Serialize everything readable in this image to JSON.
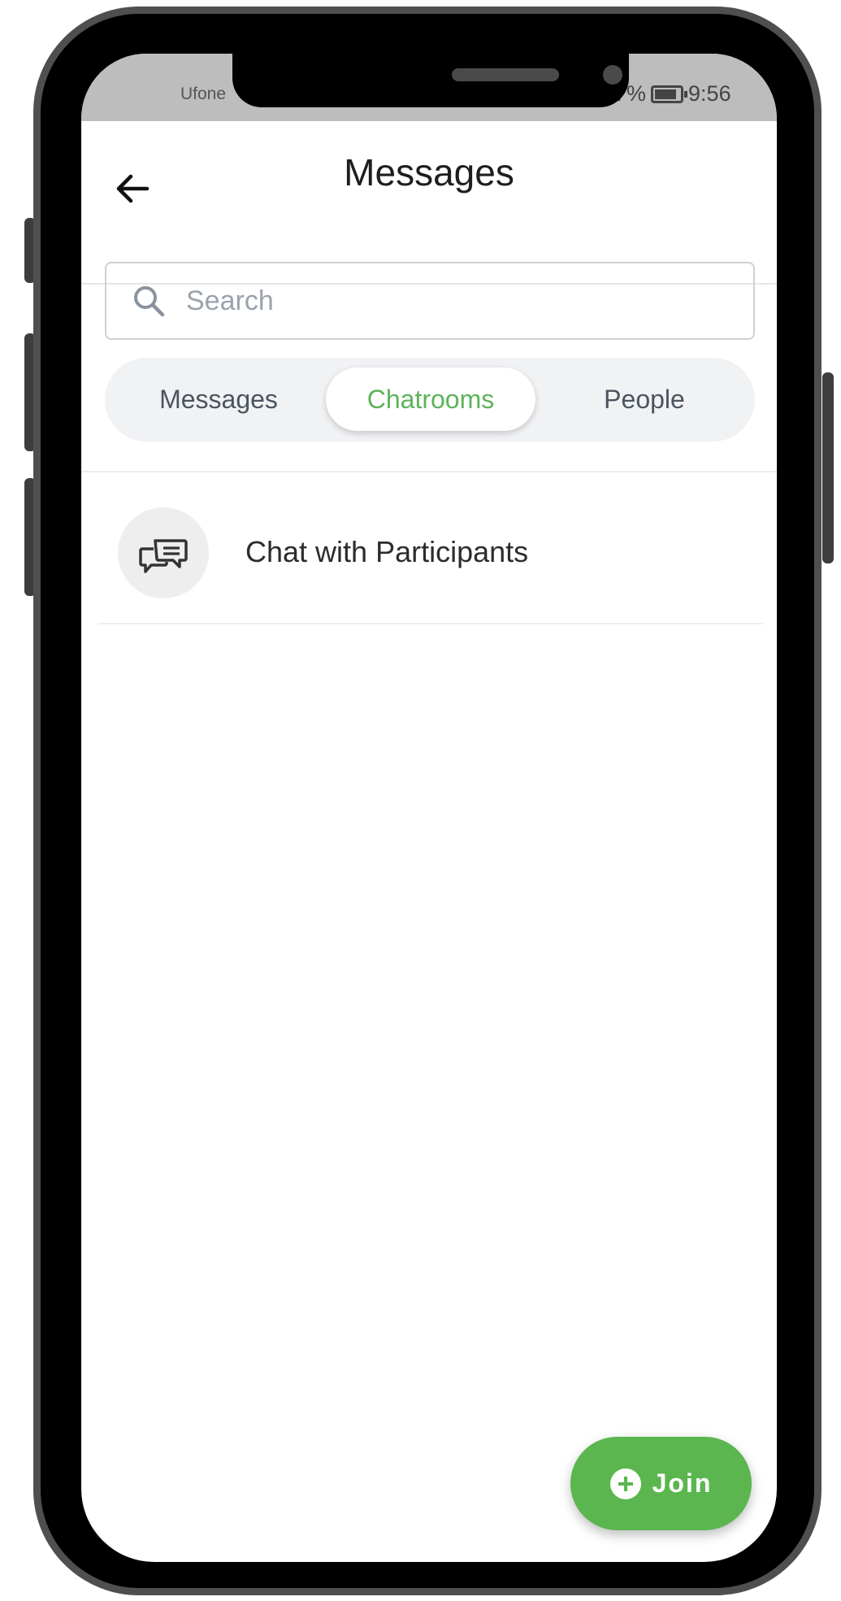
{
  "status_bar": {
    "carrier": "Ufone",
    "battery_percent": "7%",
    "time": "9:56"
  },
  "header": {
    "title": "Messages"
  },
  "search": {
    "placeholder": "Search"
  },
  "tabs": [
    {
      "label": "Messages",
      "active": false
    },
    {
      "label": "Chatrooms",
      "active": true
    },
    {
      "label": "People",
      "active": false
    }
  ],
  "chatrooms": [
    {
      "label": "Chat with Participants",
      "icon": "chat-bubbles-icon"
    }
  ],
  "fab": {
    "label": "Join",
    "icon": "plus-circle-icon"
  },
  "colors": {
    "accent": "#5bb64f",
    "active_tab_text": "#5db35a"
  }
}
